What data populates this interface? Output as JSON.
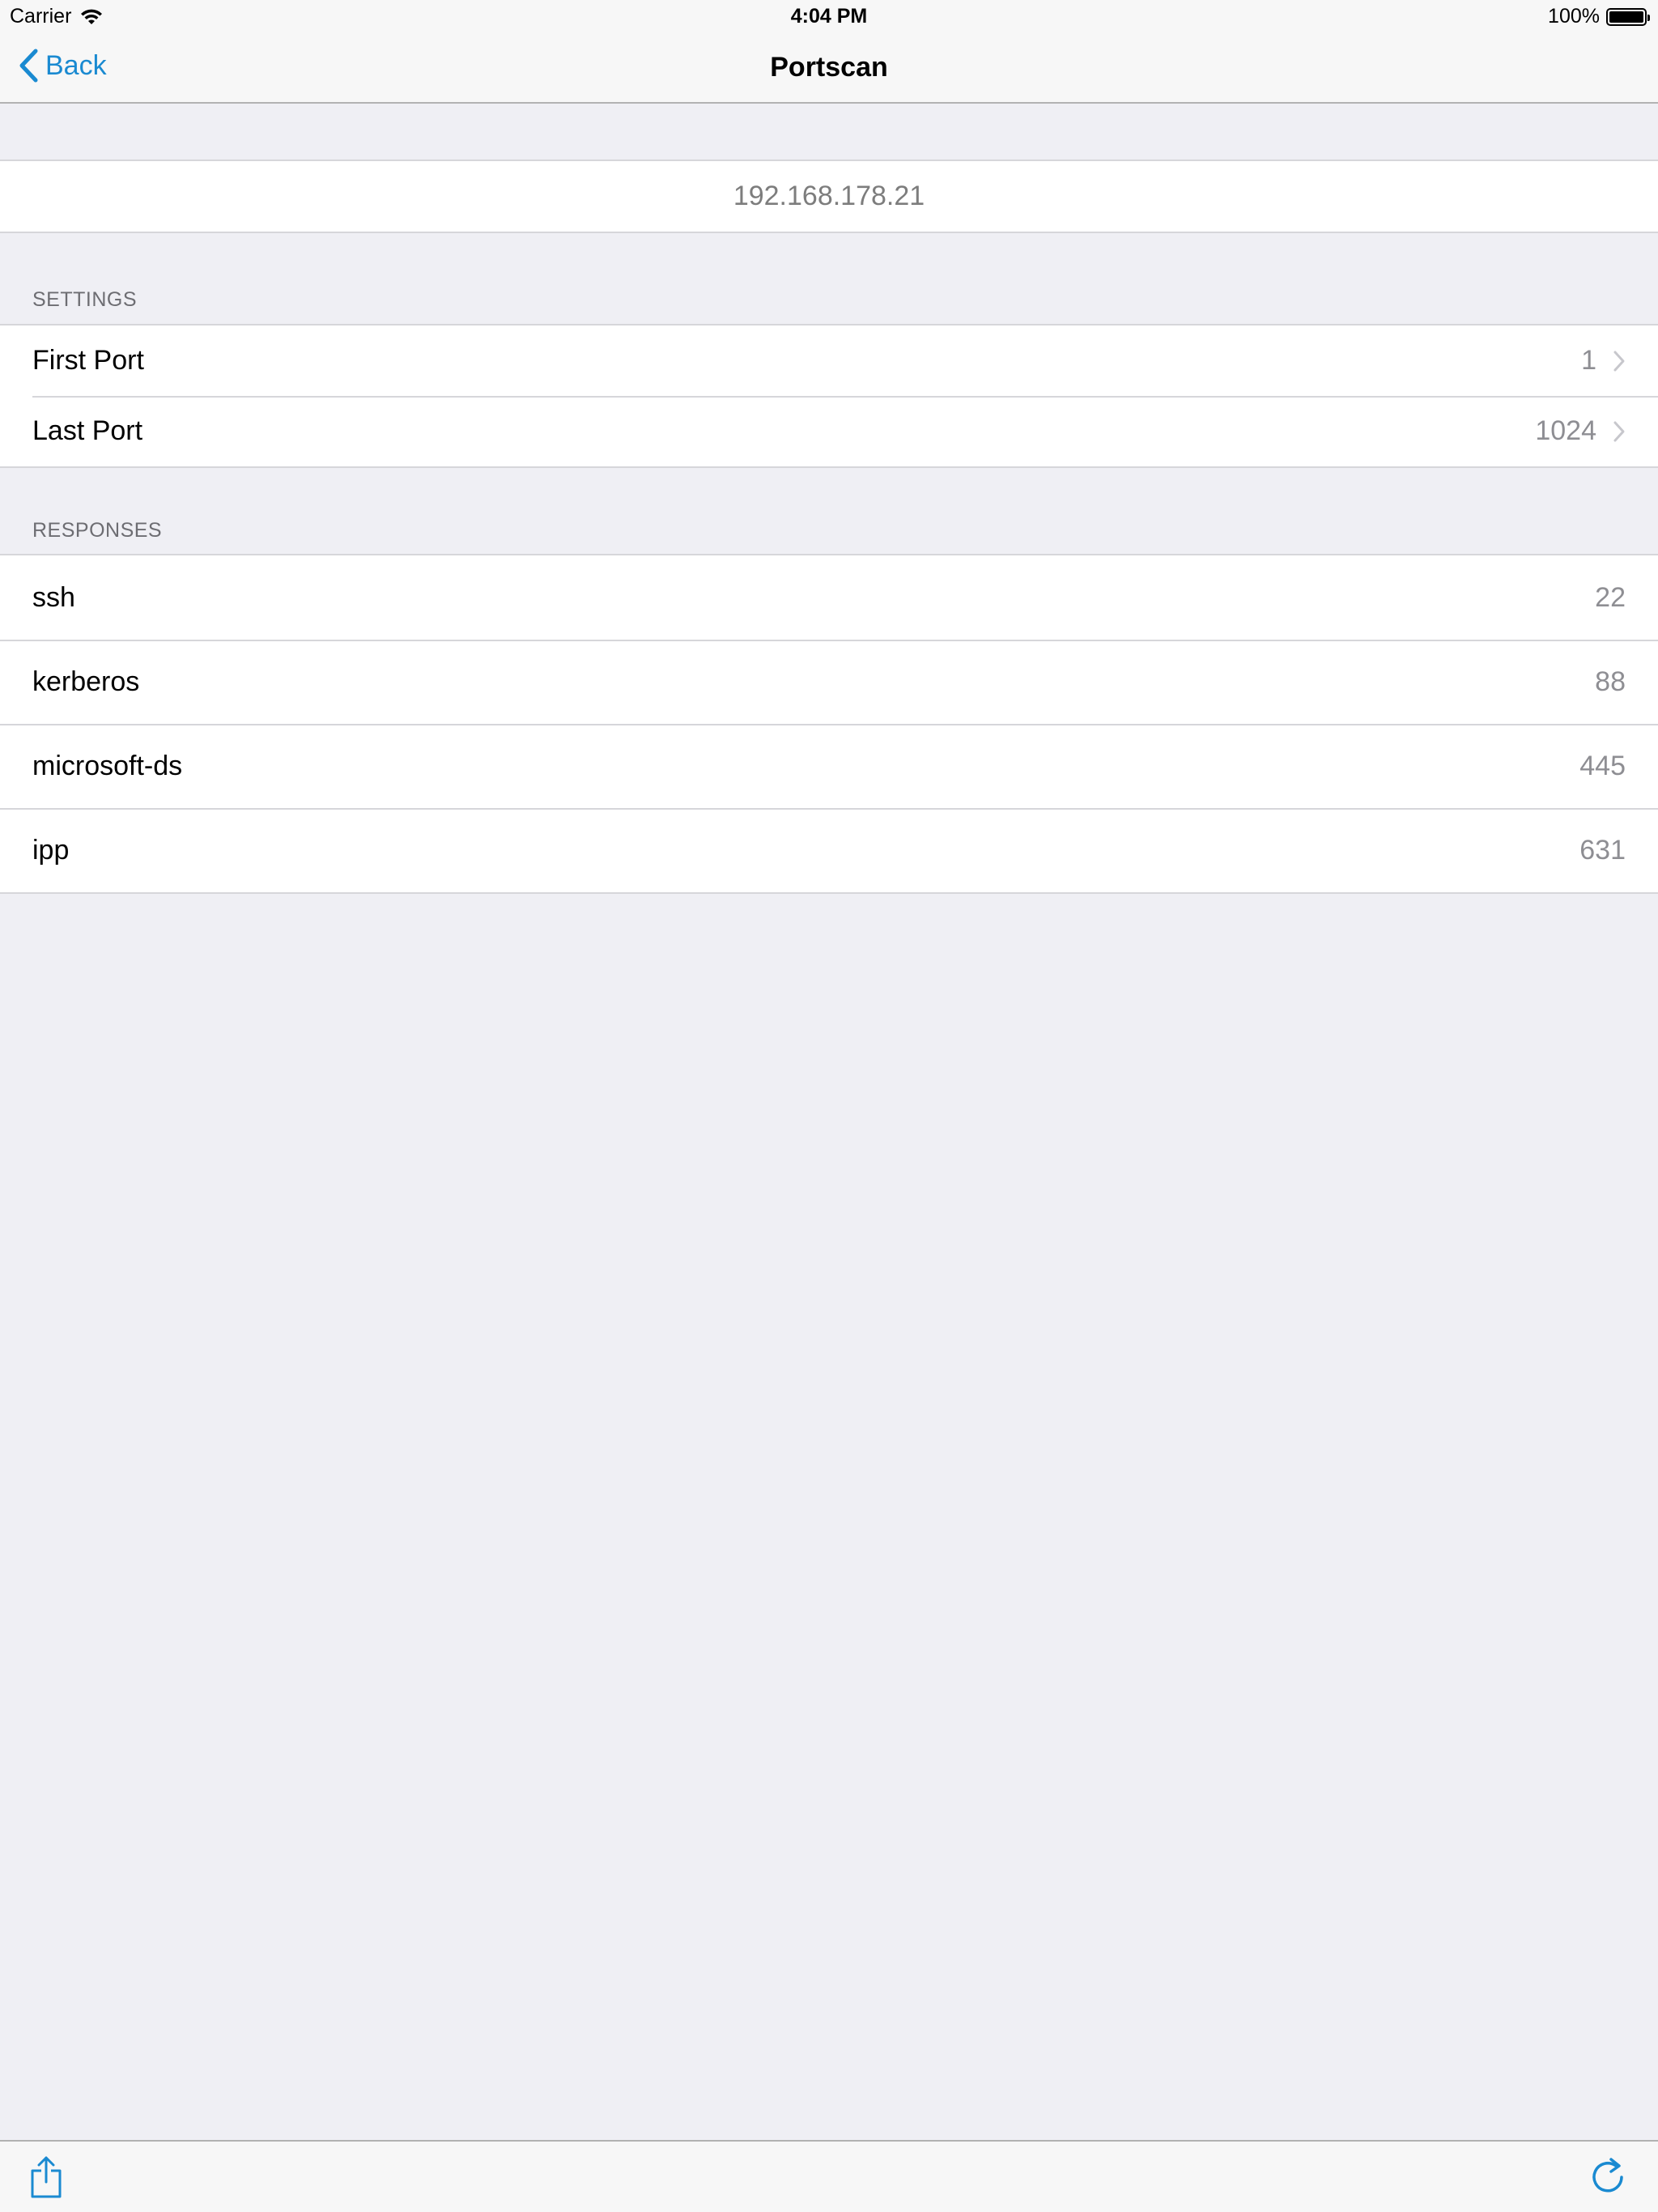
{
  "status_bar": {
    "carrier": "Carrier",
    "time": "4:04 PM",
    "battery": "100%",
    "battery_level": 1.0
  },
  "nav": {
    "back_label": "Back",
    "title": "Portscan"
  },
  "target": {
    "ip": "192.168.178.21"
  },
  "settings": {
    "header": "SETTINGS",
    "rows": [
      {
        "label": "First Port",
        "value": "1"
      },
      {
        "label": "Last Port",
        "value": "1024"
      }
    ]
  },
  "responses": {
    "header": "RESPONSES",
    "rows": [
      {
        "label": "ssh",
        "value": "22"
      },
      {
        "label": "kerberos",
        "value": "88"
      },
      {
        "label": "microsoft-ds",
        "value": "445"
      },
      {
        "label": "ipp",
        "value": "631"
      }
    ]
  },
  "toolbar": {
    "left_icon": "share-icon",
    "right_icon": "refresh-icon"
  },
  "colors": {
    "accent": "#1a8ad1",
    "background": "#efeff4",
    "secondary_text": "#8e8e93"
  }
}
